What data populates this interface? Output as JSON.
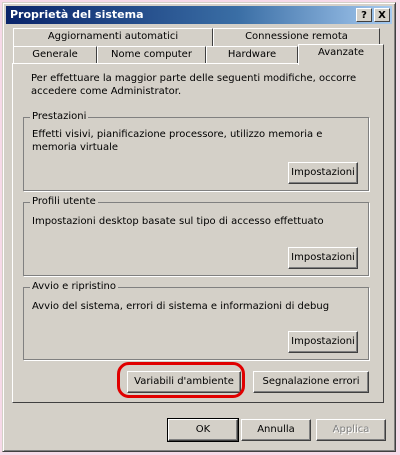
{
  "window": {
    "title": "Proprietà del sistema",
    "help_label": "?",
    "close_label": "X"
  },
  "tabs": {
    "row1": [
      {
        "label": "Aggiornamenti automatici"
      },
      {
        "label": "Connessione remota"
      }
    ],
    "row2": [
      {
        "label": "Generale"
      },
      {
        "label": "Nome computer"
      },
      {
        "label": "Hardware"
      },
      {
        "label": "Avanzate"
      }
    ]
  },
  "panel": {
    "intro": "Per effettuare la maggior parte delle seguenti modifiche, occorre accedere come Administrator.",
    "groups": [
      {
        "title": "Prestazioni",
        "text": "Effetti visivi, pianificazione processore, utilizzo memoria e memoria virtuale",
        "button": "Impostazioni"
      },
      {
        "title": "Profili utente",
        "text": "Impostazioni desktop basate sul tipo di accesso effettuato",
        "button": "Impostazioni"
      },
      {
        "title": "Avvio e ripristino",
        "text": "Avvio del sistema, errori di sistema e informazioni di debug",
        "button": "Impostazioni"
      }
    ],
    "env_button": "Variabili d'ambiente",
    "error_button": "Segnalazione errori"
  },
  "footer": {
    "ok": "OK",
    "cancel": "Annulla",
    "apply": "Applica"
  },
  "colors": {
    "titlebar": "#0a246a",
    "highlight": "#e00000",
    "face": "#d4d0c8"
  }
}
